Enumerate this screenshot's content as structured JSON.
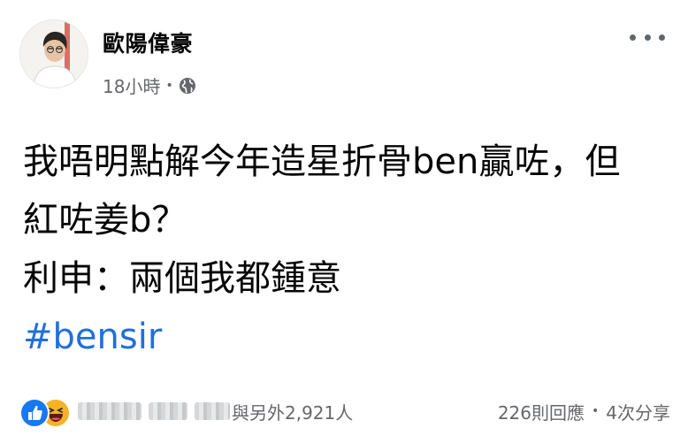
{
  "post": {
    "author": "歐陽偉豪",
    "time": "18小時",
    "separator": "•",
    "privacy_icon": "globe-icon",
    "more_icon": "more-options-icon",
    "lines": [
      "我唔明點解今年造星折骨ben贏咗，但",
      "紅咗姜b？",
      "利申：兩個我都鍾意"
    ],
    "hashtag": "#bensir"
  },
  "footer": {
    "reaction_icons": [
      "like-icon",
      "haha-icon"
    ],
    "others_text": "與另外2,921人",
    "comments": "226則回應",
    "separator": "•",
    "shares": "4次分享"
  },
  "colors": {
    "like": "#1877f2",
    "haha": "#f7b125",
    "hashtag": "#216fdb",
    "meta": "#65676b"
  }
}
